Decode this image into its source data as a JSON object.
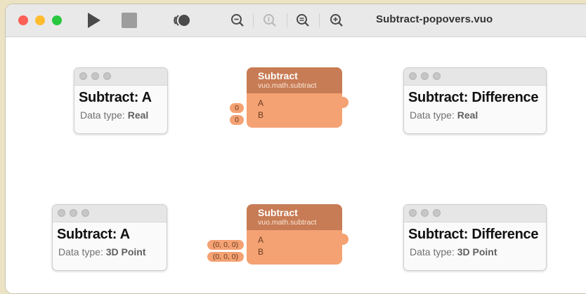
{
  "window": {
    "title": "Subtract-popovers.vuo"
  },
  "toolbar": {
    "run": "play-icon",
    "stop": "stop-icon",
    "share": "input-editor-icon",
    "zoom_out": "zoom-out-icon",
    "zoom_actual": "zoom-actual-size-icon",
    "zoom_fit": "zoom-to-fit-icon",
    "zoom_in": "zoom-in-icon"
  },
  "top_row": {
    "popover_a": {
      "title": "Subtract: A",
      "type_prefix": "Data type:",
      "type": "Real"
    },
    "node": {
      "title": "Subtract",
      "class": "vuo.math.subtract",
      "port_a": "A",
      "port_b": "B",
      "value_a": "0",
      "value_b": "0"
    },
    "popover_diff": {
      "title": "Subtract: Difference",
      "type_prefix": "Data type:",
      "type": "Real"
    }
  },
  "bottom_row": {
    "popover_a": {
      "title": "Subtract: A",
      "type_prefix": "Data type:",
      "type": "3D Point"
    },
    "node": {
      "title": "Subtract",
      "class": "vuo.math.subtract",
      "port_a": "A",
      "port_b": "B",
      "value_a": "(0, 0, 0)",
      "value_b": "(0, 0, 0)"
    },
    "popover_diff": {
      "title": "Subtract: Difference",
      "type_prefix": "Data type:",
      "type": "3D Point"
    }
  }
}
